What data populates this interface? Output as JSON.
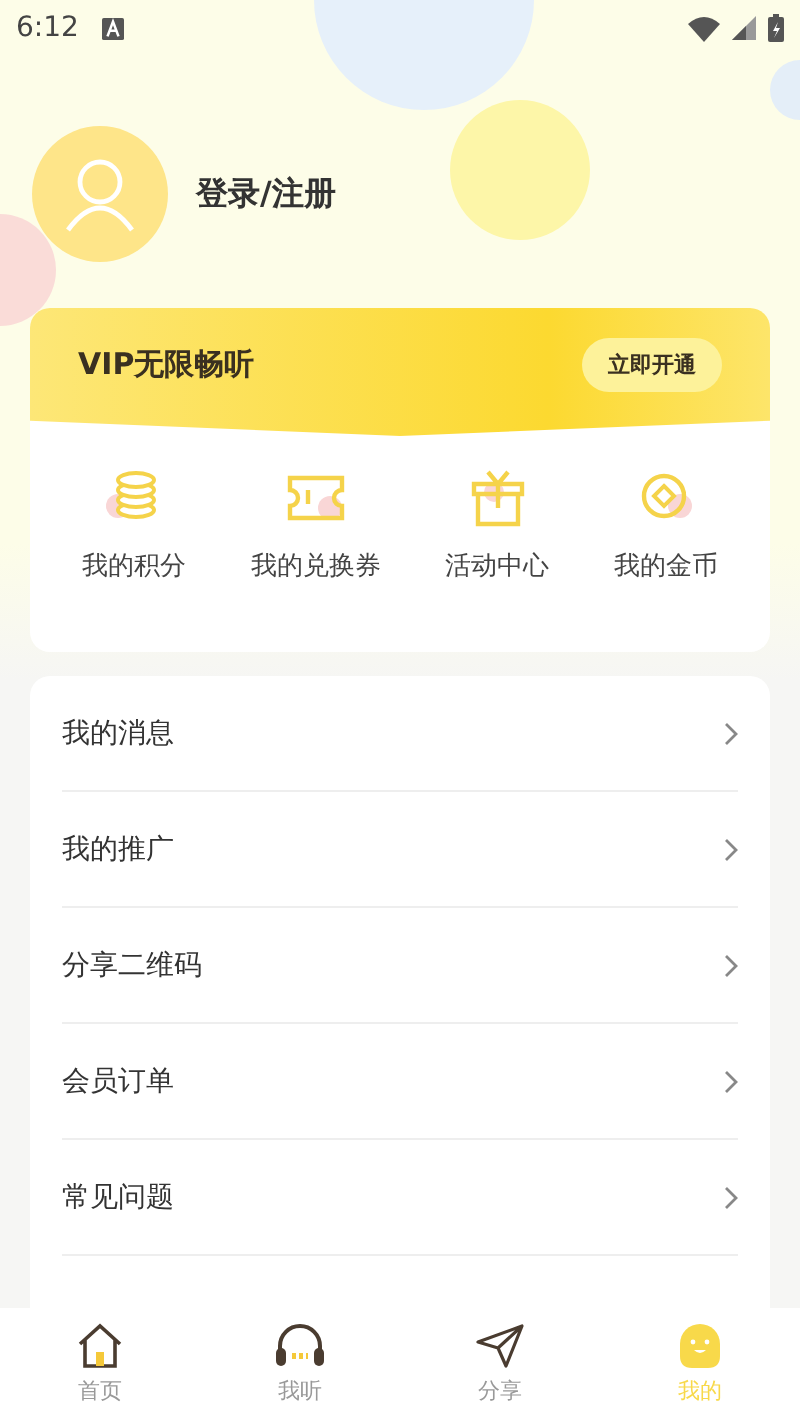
{
  "status_bar": {
    "time": "6:12"
  },
  "profile": {
    "login_label": "登录/注册"
  },
  "vip_card": {
    "title": "VIP无限畅听",
    "button": "立即开通",
    "shortcuts": [
      {
        "kind": "coins",
        "label": "我的积分"
      },
      {
        "kind": "ticket",
        "label": "我的兑换券"
      },
      {
        "kind": "gift",
        "label": "活动中心"
      },
      {
        "kind": "coin",
        "label": "我的金币"
      }
    ]
  },
  "menu": [
    {
      "label": "我的消息"
    },
    {
      "label": "我的推广"
    },
    {
      "label": "分享二维码"
    },
    {
      "label": "会员订单"
    },
    {
      "label": "常见问题"
    }
  ],
  "tab_bar": [
    {
      "kind": "home",
      "label": "首页",
      "selected": false
    },
    {
      "kind": "headphones",
      "label": "我听",
      "selected": false
    },
    {
      "kind": "send",
      "label": "分享",
      "selected": false
    },
    {
      "kind": "me",
      "label": "我的",
      "selected": true
    }
  ]
}
